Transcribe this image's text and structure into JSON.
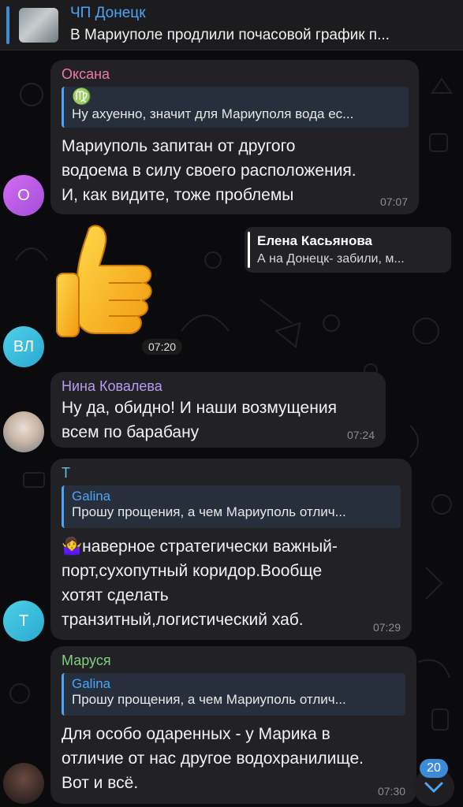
{
  "pinned": {
    "title": "ЧП Донецк",
    "text": "В Мариуполе продлили почасовой график п..."
  },
  "messages": [
    {
      "sender": "Оксана",
      "sender_color": "#ee7aa8",
      "reply_icon": "♍",
      "reply_text": "Ну ахуенно, значит для Мариуполя вода ес...",
      "lines": [
        "Мариуполь запитан от другого",
        "водоема в силу своего расположения.",
        "И, как видите, тоже проблемы"
      ],
      "time": "07:07",
      "avatar": "О"
    },
    {
      "reply_name": "Елена Касьянова",
      "reply_text": "А на Донецк- забили, м...",
      "time": "07:20",
      "avatar": "ВЛ"
    },
    {
      "sender": "Нина Ковалева",
      "sender_color": "#b79cf0",
      "lines": [
        "Ну да, обидно! И наши возмущения",
        "всем по барабану"
      ],
      "time": "07:24"
    },
    {
      "sender": "Т",
      "sender_color": "#57c7e3",
      "reply_name": "Galina",
      "reply_text": "Прошу прощения, а чем Мариуполь отлич...",
      "lines": [
        "🤷‍♀️наверное стратегически важный-",
        "порт,сухопутный коридор.Вообще",
        "хотят сделать",
        "транзитный,логистический хаб."
      ],
      "time": "07:29",
      "avatar": "Т"
    },
    {
      "sender": "Маруся",
      "sender_color": "#7fd07a",
      "reply_name": "Galina",
      "reply_text": "Прошу прощения, а чем Мариуполь отлич...",
      "lines": [
        "Для особо одаренных - у Марика в",
        "отличие от нас другое водохранилище.",
        "Вот и всё."
      ],
      "time": "07:30"
    }
  ],
  "scroll": {
    "unread_count": "20"
  },
  "colors": {
    "accent": "#4ea4f6",
    "bubble": "#222226",
    "background": "#0b0b0d"
  }
}
